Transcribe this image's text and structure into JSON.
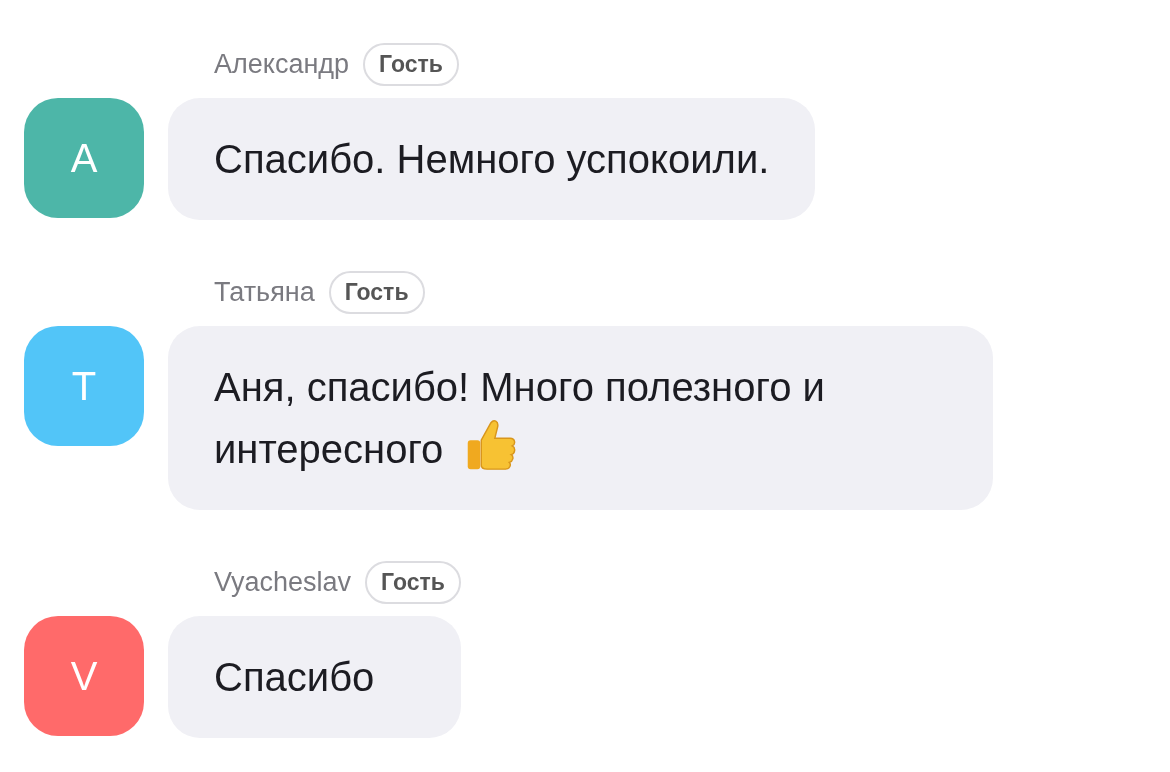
{
  "messages": [
    {
      "kind": "text",
      "initial": "A",
      "color": "#4db6a8",
      "author": "Александр",
      "badge": "Гость",
      "text": "Спасибо. Немного успокоили."
    },
    {
      "kind": "text_with_emoji",
      "initial": "T",
      "color": "#52c5f8",
      "author": "Татьяна",
      "badge": "Гость",
      "text": "Аня, спасибо! Много полезного и интересного"
    },
    {
      "kind": "text",
      "initial": "V",
      "color": "#ff6a6a",
      "author": "Vyacheslav",
      "badge": "Гость",
      "text": "Спасибо"
    }
  ]
}
